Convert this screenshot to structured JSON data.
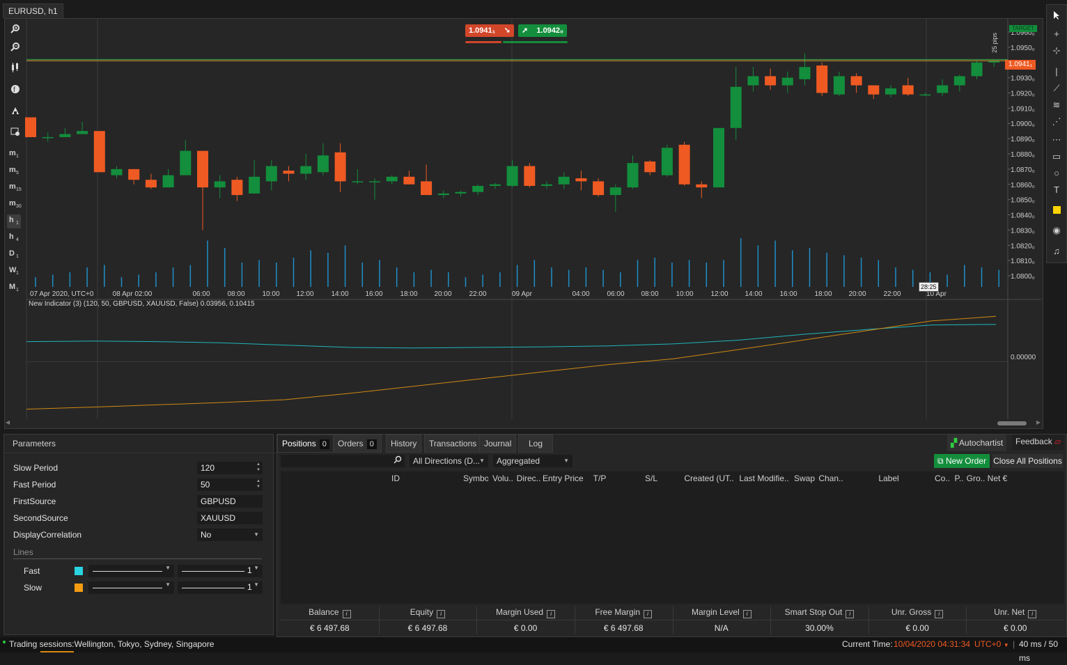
{
  "window": {
    "tab_title": "EURUSD, h1"
  },
  "chart": {
    "sell_price": "1.0941₁",
    "buy_price": "1.0942₀",
    "current_price_label": "1.0941₁",
    "target_label": "TARGET",
    "pips_label": "25 pips",
    "countdown": "28:25",
    "y_ticks": [
      "1.0960₀",
      "1.0950₀",
      "1.0930₀",
      "1.0920₀",
      "1.0910₀",
      "1.0900₀",
      "1.0890₀",
      "1.0880₀",
      "1.0870₀",
      "1.0860₀",
      "1.0850₀",
      "1.0840₀",
      "1.0830₀",
      "1.0820₀",
      "1.0810₀",
      "1.0800₀"
    ],
    "x_ticks": [
      "07 Apr 2020, UTC+0",
      "08 Apr 02:00",
      "06:00",
      "08:00",
      "10:00",
      "12:00",
      "14:00",
      "16:00",
      "18:00",
      "20:00",
      "22:00",
      "09 Apr",
      "04:00",
      "06:00",
      "08:00",
      "10:00",
      "12:00",
      "14:00",
      "16:00",
      "18:00",
      "20:00",
      "22:00",
      "10 Apr"
    ],
    "timeframes": [
      {
        "m": "m",
        "s": "1"
      },
      {
        "m": "m",
        "s": "5"
      },
      {
        "m": "m",
        "s": "15"
      },
      {
        "m": "m",
        "s": "30"
      },
      {
        "m": "h",
        "s": "1"
      },
      {
        "m": "h",
        "s": "4"
      },
      {
        "m": "D",
        "s": "1"
      },
      {
        "m": "W",
        "s": "1"
      },
      {
        "m": "M",
        "s": "1"
      }
    ],
    "active_timeframe_index": 4,
    "indicator_label": "New Indicator (3) (120, 50, GBPUSD, XAUUSD, False) 0.03956, 0.10415",
    "indicator_y_tick": "0.00000",
    "colors": {
      "bull": "#138e3c",
      "bear": "#ef5a23",
      "volume": "#1f8fc9",
      "fast_line": "#1fb6bd",
      "slow_line": "#d18a12",
      "price_line": "#d8a232"
    }
  },
  "chart_data": {
    "type": "candlestick",
    "x_unit": "hourly bars from 07 Apr 2020 21:00 UTC",
    "ohlc": [
      [
        1.0904,
        1.0904,
        1.0891,
        1.0891
      ],
      [
        1.0891,
        1.0894,
        1.0888,
        1.0891
      ],
      [
        1.0891,
        1.0897,
        1.0891,
        1.0893
      ],
      [
        1.0893,
        1.0901,
        1.0893,
        1.0895
      ],
      [
        1.0895,
        1.0895,
        1.0868,
        1.0868
      ],
      [
        1.0866,
        1.0872,
        1.0864,
        1.087
      ],
      [
        1.087,
        1.087,
        1.086,
        1.0863
      ],
      [
        1.0863,
        1.0867,
        1.0857,
        1.0858
      ],
      [
        1.0858,
        1.087,
        1.0858,
        1.0866
      ],
      [
        1.0866,
        1.0889,
        1.0866,
        1.0882
      ],
      [
        1.0882,
        1.0882,
        1.083,
        1.0858
      ],
      [
        1.0858,
        1.0866,
        1.0851,
        1.0862
      ],
      [
        1.0863,
        1.0865,
        1.0849,
        1.0853
      ],
      [
        1.0854,
        1.0876,
        1.0854,
        1.0865
      ],
      [
        1.0862,
        1.0876,
        1.0856,
        1.0872
      ],
      [
        1.0869,
        1.0872,
        1.0862,
        1.0867
      ],
      [
        1.0867,
        1.088,
        1.0863,
        1.0872
      ],
      [
        1.0868,
        1.0887,
        1.0866,
        1.0879
      ],
      [
        1.0881,
        1.0887,
        1.0855,
        1.0862
      ],
      [
        1.0862,
        1.087,
        1.086,
        1.0862
      ],
      [
        1.0862,
        1.0864,
        1.085,
        1.0862
      ],
      [
        1.0862,
        1.0866,
        1.086,
        1.0865
      ],
      [
        1.0865,
        1.0869,
        1.086,
        1.086
      ],
      [
        1.0862,
        1.0873,
        1.0857,
        1.0853
      ],
      [
        1.0853,
        1.0856,
        1.0851,
        1.0854
      ],
      [
        1.0854,
        1.0856,
        1.0852,
        1.0855
      ],
      [
        1.0855,
        1.086,
        1.0853,
        1.0859
      ],
      [
        1.0859,
        1.0861,
        1.0857,
        1.086
      ],
      [
        1.0859,
        1.0876,
        1.0858,
        1.0872
      ],
      [
        1.0872,
        1.0874,
        1.0858,
        1.0859
      ],
      [
        1.0859,
        1.0862,
        1.0857,
        1.086
      ],
      [
        1.086,
        1.0868,
        1.0857,
        1.0865
      ],
      [
        1.0864,
        1.0869,
        1.0856,
        1.0862
      ],
      [
        1.0862,
        1.0864,
        1.0852,
        1.0853
      ],
      [
        1.0853,
        1.086,
        1.0842,
        1.0858
      ],
      [
        1.0858,
        1.0879,
        1.0857,
        1.0874
      ],
      [
        1.0875,
        1.0876,
        1.0866,
        1.0868
      ],
      [
        1.0866,
        1.0886,
        1.0865,
        1.0884
      ],
      [
        1.0886,
        1.0888,
        1.0859,
        1.086
      ],
      [
        1.086,
        1.0862,
        1.0851,
        1.0858
      ],
      [
        1.0858,
        1.0897,
        1.0858,
        1.0897
      ],
      [
        1.0897,
        1.0937,
        1.0889,
        1.0924
      ],
      [
        1.0925,
        1.0937,
        1.0921,
        1.0931
      ],
      [
        1.0931,
        1.0936,
        1.0922,
        1.0925
      ],
      [
        1.0925,
        1.0934,
        1.092,
        1.093
      ],
      [
        1.0929,
        1.0946,
        1.0925,
        1.0937
      ],
      [
        1.0938,
        1.094,
        1.0918,
        1.092
      ],
      [
        1.0919,
        1.0934,
        1.0918,
        1.0931
      ],
      [
        1.0931,
        1.0933,
        1.092,
        1.0925
      ],
      [
        1.0925,
        1.0925,
        1.0916,
        1.0919
      ],
      [
        1.0919,
        1.0925,
        1.0917,
        1.0923
      ],
      [
        1.0925,
        1.093,
        1.0918,
        1.0919
      ],
      [
        1.0919,
        1.092,
        1.0918,
        1.0919
      ],
      [
        1.092,
        1.0929,
        1.0918,
        1.0925
      ],
      [
        1.0925,
        1.0932,
        1.0921,
        1.0931
      ],
      [
        1.0931,
        1.0941,
        1.0929,
        1.094
      ],
      [
        1.094,
        1.0941,
        1.0937,
        1.0941
      ]
    ],
    "volume_relative": [
      0.2,
      0.25,
      0.3,
      0.4,
      0.45,
      0.2,
      0.25,
      0.3,
      0.4,
      0.45,
      0.95,
      0.8,
      0.5,
      0.55,
      0.5,
      0.6,
      0.75,
      0.7,
      0.85,
      0.5,
      0.55,
      0.4,
      0.3,
      0.35,
      0.3,
      0.2,
      0.25,
      0.3,
      0.45,
      0.55,
      0.4,
      0.35,
      0.4,
      0.35,
      0.3,
      0.55,
      0.6,
      0.5,
      0.55,
      0.5,
      0.55,
      1.0,
      0.85,
      0.95,
      0.75,
      0.8,
      0.7,
      0.65,
      0.6,
      0.55,
      0.4,
      0.35,
      0.3,
      0.25,
      0.45,
      0.4,
      0.35
    ],
    "indicator": {
      "series": [
        {
          "name": "Fast",
          "values": [
            0.07,
            0.072,
            0.07,
            0.066,
            0.058,
            0.05,
            0.048,
            0.05,
            0.052,
            0.055,
            0.062,
            0.075,
            0.095,
            0.112,
            0.128,
            0.13
          ]
        },
        {
          "name": "Slow",
          "values": [
            -0.165,
            -0.158,
            -0.15,
            -0.142,
            -0.132,
            -0.11,
            -0.085,
            -0.06,
            -0.035,
            -0.01,
            0.01,
            0.042,
            0.075,
            0.108,
            0.142,
            0.158
          ]
        }
      ],
      "current_values": {
        "Fast": 0.03956,
        "Slow": 0.10415
      }
    }
  },
  "params": {
    "title": "Parameters",
    "fields": [
      {
        "label": "Slow Period",
        "value": "120",
        "kind": "spin"
      },
      {
        "label": "Fast Period",
        "value": "50",
        "kind": "spin"
      },
      {
        "label": "FirstSource",
        "value": "GBPUSD",
        "kind": "text"
      },
      {
        "label": "SecondSource",
        "value": "XAUUSD",
        "kind": "text"
      },
      {
        "label": "DisplayCorrelation",
        "value": "No",
        "kind": "select"
      }
    ],
    "lines_title": "Lines",
    "lines": [
      {
        "label": "Fast",
        "color": "#29d4e0",
        "thickness": "1"
      },
      {
        "label": "Slow",
        "color": "#f39c12",
        "thickness": "1"
      }
    ]
  },
  "bottom": {
    "tabs": [
      {
        "label": "Positions",
        "count": "0"
      },
      {
        "label": "Orders",
        "count": "0"
      },
      {
        "label": "History"
      },
      {
        "label": "Transactions"
      },
      {
        "label": "Journal"
      },
      {
        "label": "Log"
      }
    ],
    "autochartist": "Autochartist",
    "feedback": "Feedback",
    "direction_filter": "All Directions (D...",
    "grouping": "Aggregated",
    "new_order": "New Order",
    "close_all": "Close All Positions",
    "columns": [
      "ID",
      "Symbo",
      "Volu..",
      "Direc..",
      "Entry Price",
      "T/P",
      "S/L",
      "Created (UT..",
      "Last Modifie..",
      "Swap",
      "Chan..",
      "Label",
      "Co..",
      "P..",
      "Gro..",
      "Net €"
    ],
    "stats": [
      {
        "label": "Balance",
        "value": "€ 6 497.68"
      },
      {
        "label": "Equity",
        "value": "€ 6 497.68"
      },
      {
        "label": "Margin Used",
        "value": "€ 0.00"
      },
      {
        "label": "Free Margin",
        "value": "€ 6 497.68"
      },
      {
        "label": "Margin Level",
        "value": "N/A"
      },
      {
        "label": "Smart Stop Out",
        "value": "30.00%"
      },
      {
        "label": "Unr. Gross",
        "value": "€ 0.00"
      },
      {
        "label": "Unr. Net",
        "value": "€ 0.00"
      }
    ]
  },
  "status": {
    "sessions": "Trading sessions:Wellington, Tokyo, Sydney, Singapore",
    "current_time_label": "Current Time:",
    "current_time": "10/04/2020 04:31:34",
    "timezone": "UTC+0",
    "latency": "40 ms / 50 ms"
  }
}
